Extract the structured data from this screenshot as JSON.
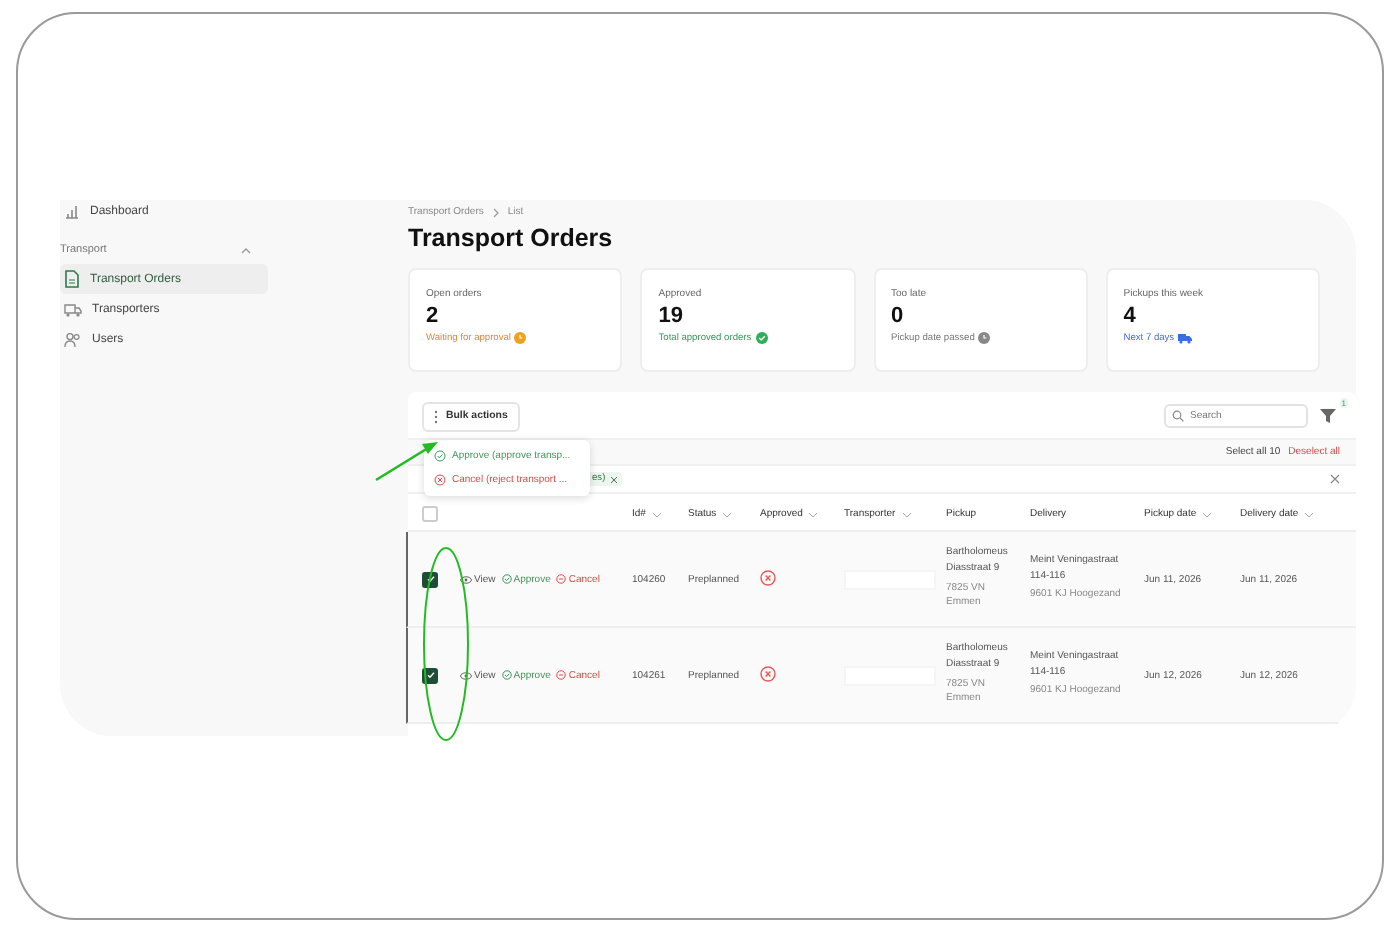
{
  "sidebar": {
    "items": [
      {
        "label": "Dashboard",
        "selected": false
      }
    ],
    "section": {
      "label": "Transport",
      "expanded": true,
      "items": [
        {
          "label": "Transport Orders",
          "selected": true
        },
        {
          "label": "Transporters",
          "selected": false
        },
        {
          "label": "Users",
          "selected": false
        }
      ]
    }
  },
  "breadcrumb": [
    "Transport Orders",
    "List"
  ],
  "title": "Transport Orders",
  "cards": [
    {
      "label": "Open orders",
      "value": "2",
      "note": "Waiting for approval",
      "kind": "warning"
    },
    {
      "label": "Approved",
      "value": "19",
      "note": "Total approved orders",
      "kind": "success"
    },
    {
      "label": "Too late",
      "value": "0",
      "note": "Pickup date passed",
      "kind": "muted"
    },
    {
      "label": "Pickups this week",
      "value": "4",
      "note": "Next 7 days",
      "kind": "info"
    }
  ],
  "toolbar": {
    "bulk_button": "Bulk actions",
    "search": {
      "placeholder": "Search"
    },
    "filter_badge": "1"
  },
  "bulk_menu": [
    {
      "label": "Approve (approve transp...",
      "kind": "approve"
    },
    {
      "label": "Cancel (reject transport ...",
      "kind": "cancel"
    }
  ],
  "selection": {
    "select_all": "Select all 10",
    "deselect_all": "Deselect all"
  },
  "filter_chip": {
    "label": "es)"
  },
  "table": {
    "header_checked": false,
    "columns": [
      {
        "label": "Id#",
        "sortable": true
      },
      {
        "label": "Status",
        "sortable": true
      },
      {
        "label": "Approved",
        "sortable": true
      },
      {
        "label": "Transporter",
        "sortable": true
      },
      {
        "label": "Pickup",
        "sortable": false
      },
      {
        "label": "Delivery",
        "sortable": false
      },
      {
        "label": "Pickup date",
        "sortable": true
      },
      {
        "label": "Delivery date",
        "sortable": true
      }
    ],
    "rows": [
      {
        "selected": true,
        "actions": [
          "View",
          "Approve",
          "Cancel"
        ],
        "id": "104260",
        "status": "Preplanned",
        "approved": false,
        "pickup_street": "Bartholomeus Diasstraat 9",
        "pickup_city": "7825 VN Emmen",
        "delivery_street": "Meint Veningastraat 114-116",
        "delivery_city": "9601 KJ Hoogezand",
        "pickup_date": "Jun 11, 2026",
        "delivery_date": "Jun 11, 2026"
      },
      {
        "selected": true,
        "actions": [
          "View",
          "Approve",
          "Cancel"
        ],
        "id": "104261",
        "status": "Preplanned",
        "approved": false,
        "pickup_street": "Bartholomeus Diasstraat 9",
        "pickup_city": "7825 VN Emmen",
        "delivery_street": "Meint Veningastraat 114-116",
        "delivery_city": "9601 KJ Hoogezand",
        "pickup_date": "Jun 12, 2026",
        "delivery_date": "Jun 12, 2026"
      }
    ]
  }
}
